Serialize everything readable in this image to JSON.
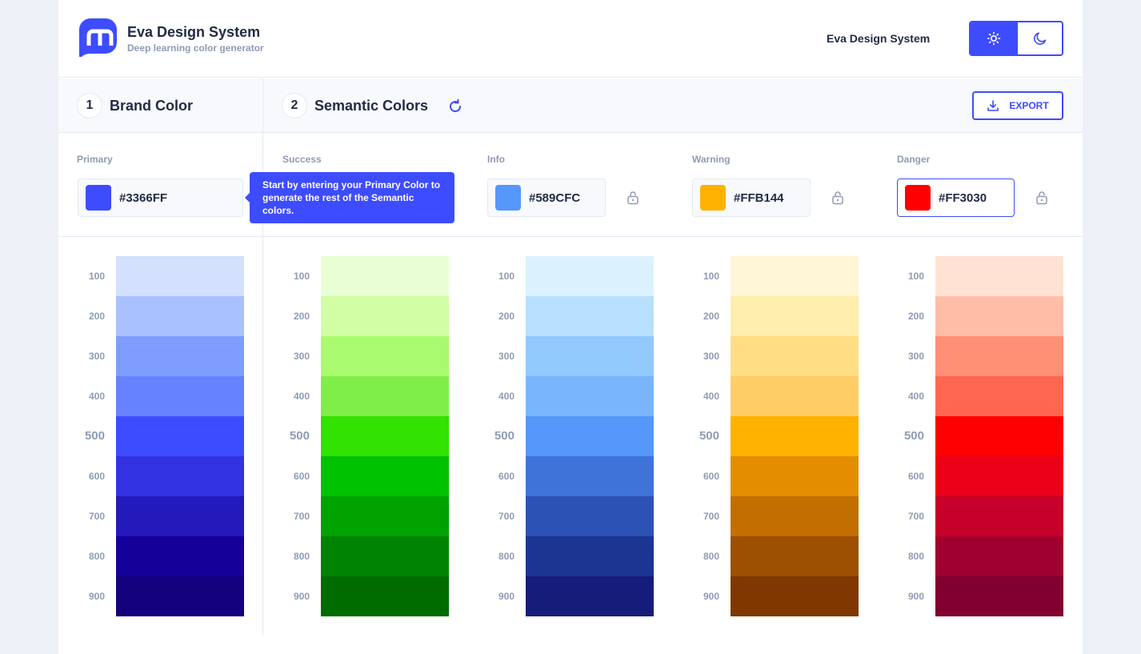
{
  "header": {
    "title": "Eva Design System",
    "subtitle": "Deep learning color generator",
    "link": "Eva Design System",
    "logo_color": "#3d4cff",
    "theme": {
      "light_icon": "sun-icon",
      "dark_icon": "moon-icon",
      "active": "light"
    }
  },
  "sections": {
    "brand": {
      "number": "1",
      "title": "Brand Color"
    },
    "semantic": {
      "number": "2",
      "title": "Semantic Colors",
      "refresh_icon": "refresh-icon"
    },
    "export_label": "EXPORT"
  },
  "tooltip": "Start by entering your Primary Color to generate the rest of the Semantic colors.",
  "inputs": {
    "primary": {
      "label": "Primary",
      "hex": "#3366FF",
      "swatch": "#3d4cff"
    },
    "success": {
      "label": "Success"
    },
    "info": {
      "label": "Info",
      "hex": "#589CFC",
      "swatch": "#5597fb"
    },
    "warning": {
      "label": "Warning",
      "hex": "#FFB144",
      "swatch": "#ffb100"
    },
    "danger": {
      "label": "Danger",
      "hex": "#FF3030",
      "swatch": "#ff0000"
    }
  },
  "shade_labels": [
    "100",
    "200",
    "300",
    "400",
    "500",
    "600",
    "700",
    "800",
    "900"
  ],
  "palettes": {
    "primary": [
      "#d3e0fe",
      "#a9c1fe",
      "#7e9dfe",
      "#6682fe",
      "#3d4cff",
      "#3232e0",
      "#2419bb",
      "#16009a",
      "#12007c"
    ],
    "success": [
      "#e9fed3",
      "#d1fea4",
      "#a9fa6f",
      "#80ee49",
      "#32e200",
      "#00c200",
      "#00a200",
      "#008300",
      "#006c00"
    ],
    "info": [
      "#dbf2fe",
      "#b7e0fe",
      "#92c9fd",
      "#79b5fd",
      "#5597fb",
      "#3f73da",
      "#2c52b6",
      "#1c3592",
      "#161c79"
    ],
    "warning": [
      "#fff6d6",
      "#ffedad",
      "#ffdd84",
      "#ffcd65",
      "#ffb100",
      "#e48d00",
      "#c26e00",
      "#9c5000",
      "#803800"
    ],
    "danger": [
      "#ffe2d4",
      "#ffbda7",
      "#ff8f75",
      "#ff6652",
      "#ff0000",
      "#ec0018",
      "#c6002a",
      "#a0002f",
      "#810030"
    ]
  }
}
